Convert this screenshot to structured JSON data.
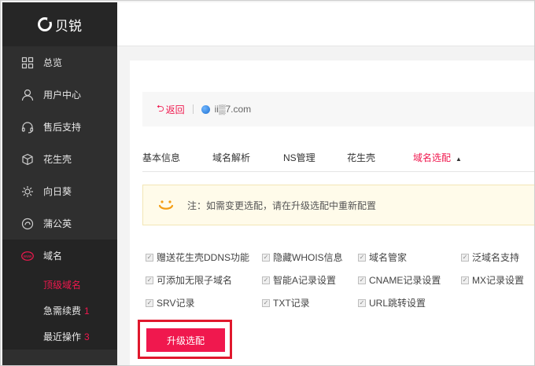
{
  "brand": {
    "name": "贝锐"
  },
  "sidebar": {
    "items": [
      {
        "label": "总览",
        "icon": "grid-icon"
      },
      {
        "label": "用户中心",
        "icon": "user-icon"
      },
      {
        "label": "售后支持",
        "icon": "headset-icon"
      },
      {
        "label": "花生壳",
        "icon": "cube-icon"
      },
      {
        "label": "向日葵",
        "icon": "sunflower-icon"
      },
      {
        "label": "蒲公英",
        "icon": "dandelion-icon"
      },
      {
        "label": "域名",
        "icon": "www-icon"
      }
    ],
    "sub_items": [
      {
        "label": "顶级域名",
        "count": ""
      },
      {
        "label": "急需续费",
        "count": "1"
      },
      {
        "label": "最近操作",
        "count": "3"
      }
    ]
  },
  "breadcrumb": {
    "back_label": "返回",
    "domain": "ii▒7.com"
  },
  "tabs": [
    "基本信息",
    "域名解析",
    "NS管理",
    "花生壳",
    "域名选配"
  ],
  "notice": {
    "text": "注：如需变更选配，请在升级选配中重新配置"
  },
  "features": [
    [
      "赠送花生壳DDNS功能",
      "隐藏WHOIS信息",
      "域名管家",
      "泛域名支持"
    ],
    [
      "可添加无限子域名",
      "智能A记录设置",
      "CNAME记录设置",
      "MX记录设置"
    ],
    [
      "SRV记录",
      "TXT记录",
      "URL跳转设置"
    ]
  ],
  "upgrade_button": {
    "label": "升级选配"
  },
  "colors": {
    "accent": "#f0184e",
    "sidebar_bg": "#2f2f2f",
    "highlight_border": "#e0182d"
  }
}
